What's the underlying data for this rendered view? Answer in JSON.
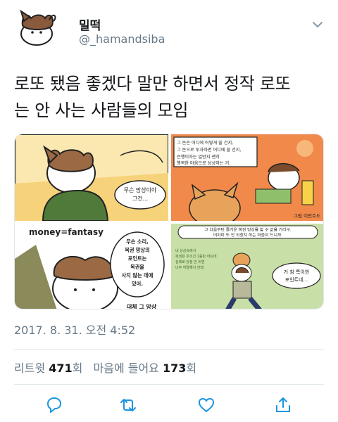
{
  "user": {
    "display_name": "밀떡",
    "handle": "@_hamandsiba"
  },
  "tweet": {
    "text_line1": "로또 됐음 좋겠다 말만 하면서 정작 로또",
    "text_line2": "는 안 사는 사람들의 모임",
    "timestamp": "2017. 8. 31. 오전 4:52"
  },
  "comic": {
    "panel1_bubble": "무슨 망상이야\n그건...",
    "panel1_bubble_l1": "무슨 망상이야",
    "panel1_bubble_l2": "그건...",
    "panel2_box_l1": "그 돈은 어디에 어떻게 쓸 건지,",
    "panel2_box_l2": "그 돈으로 투자하면 어디에 쓸 건지,",
    "panel2_box_l3": "은행이자는 얼만지 괜히",
    "panel2_box_l4": "행복한 마음으로 상상하는 거.",
    "panel2_caption": "그럼 이번주도",
    "panel3_title": "money=fantasy",
    "panel3_bubble_l1": "무슨 소리,",
    "panel3_bubble_l2": "복권 망상의",
    "panel3_bubble_l3": "포인트는",
    "panel3_bubble_l4": "복권을",
    "panel3_bubble_l5": "사지 않는 데에",
    "panel3_bubble_l6": "있어.",
    "panel3_bottom": "대체 그 망상",
    "panel4_box_l1": "그 다음부턴 즐거운 복권 망상을 할 수 없을 거라구.",
    "panel4_box_l2": "어차피 또 안 되겠지 하는 마음이 드니까.",
    "panel4_small_l1": "내 상상속에서",
    "panel4_small_l2": "복권은 우조건 1등만 하는데",
    "panel4_small_l3": "실제로 당첨 안 되면",
    "panel4_small_l4": "너무 허탈해서 안돼",
    "panel4_bubble_l1": "거 참 특이한",
    "panel4_bubble_l2": "포인트네..."
  },
  "stats": {
    "retweets_label": "리트윗",
    "retweets_count": "471",
    "retweets_unit": "회",
    "likes_label": "마음에 들어요",
    "likes_count": "173",
    "likes_unit": "회"
  },
  "icons": {
    "reply": "reply-icon",
    "retweet": "retweet-icon",
    "like": "heart-icon",
    "share": "share-icon",
    "caret": "chevron-down-icon"
  },
  "colors": {
    "text": "#14171a",
    "secondary": "#657786",
    "border": "#e1e8ed",
    "icon": "#1b95e0"
  }
}
